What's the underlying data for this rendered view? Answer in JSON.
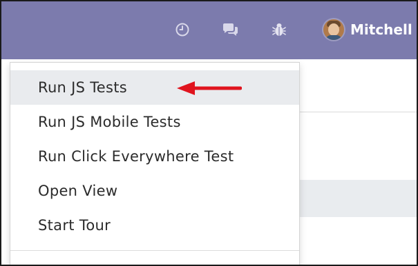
{
  "navbar": {
    "background_color": "#7c7bad",
    "icons": [
      "clock-icon",
      "chat-icon",
      "bug-icon"
    ],
    "user": {
      "name": "Mitchell"
    }
  },
  "dropdown": {
    "items": [
      {
        "label": "Run JS Tests",
        "highlighted": true
      },
      {
        "label": "Run JS Mobile Tests",
        "highlighted": false
      },
      {
        "label": "Run Click Everywhere Test",
        "highlighted": false
      },
      {
        "label": "Open View",
        "highlighted": false
      },
      {
        "label": "Start Tour",
        "highlighted": false
      }
    ]
  },
  "annotation": {
    "arrow_color": "#e0141e",
    "points_to": "Run JS Tests"
  }
}
